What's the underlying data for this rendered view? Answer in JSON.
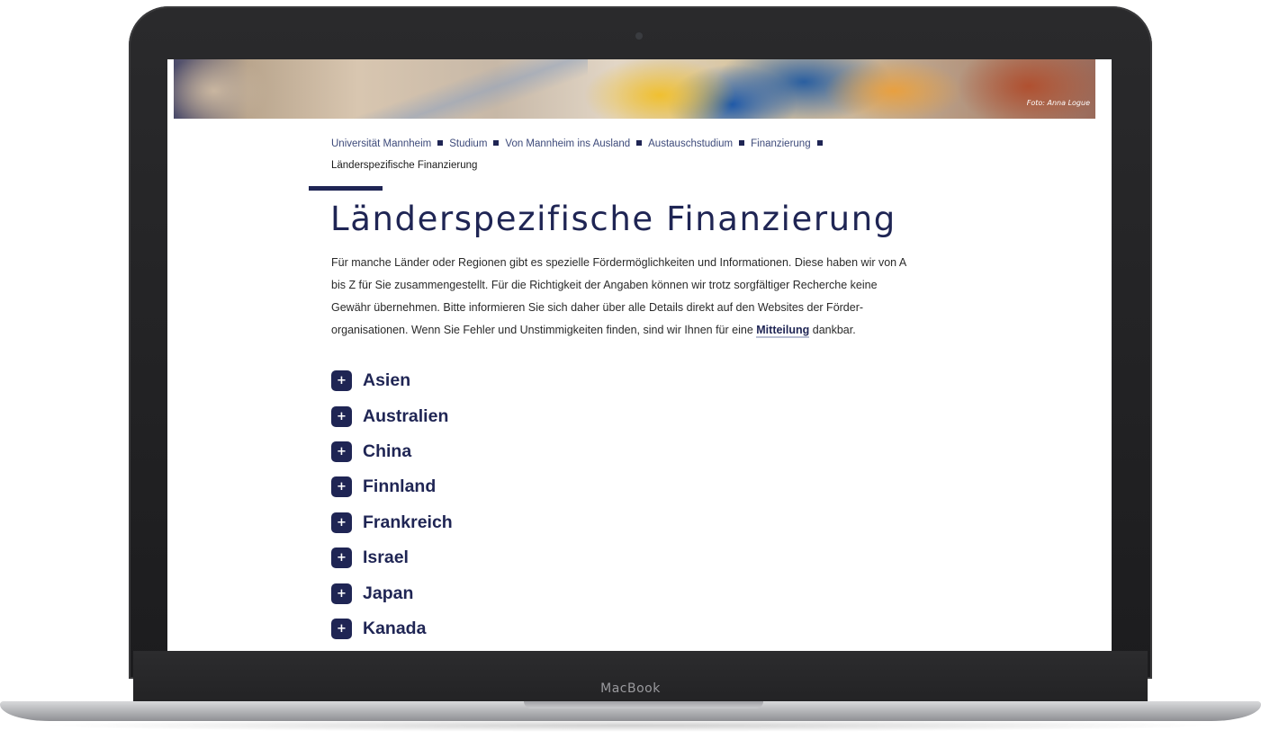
{
  "device": {
    "brand": "MacBook"
  },
  "hero": {
    "credit": "Foto: Anna Logue"
  },
  "breadcrumb": {
    "items": [
      "Universität Mannheim",
      "Studium",
      "Von Mannheim ins Ausland",
      "Austauschstudium",
      "Finanzierung"
    ],
    "current": "Länderspezifische Finanzierung"
  },
  "page": {
    "title": "Länderspezifische Finanzierung",
    "intro": {
      "line1": "Für manche Länder oder Regionen gibt es spezielle Fördermöglichkeiten und Informationen. Diese haben wir von A",
      "line2": "bis Z für Sie zusammengestellt. Für die Richtigkeit der Angaben können wir trotz sorgfältiger Recherche keine",
      "line3": "Gewähr übernehmen. Bitte informieren Sie sich daher über alle Details direkt auf den Websites der Förder-",
      "line4_before": "organisationen. Wenn Sie Fehler und Unstimmigkeiten finden, sind wir Ihnen für eine ",
      "link": "Mitteilung",
      "line4_after": " dankbar."
    }
  },
  "accordion": {
    "expand_symbol": "+",
    "items": [
      "Asien",
      "Australien",
      "China",
      "Finnland",
      "Frankreich",
      "Israel",
      "Japan",
      "Kanada"
    ]
  },
  "colors": {
    "navy": "#1f2554",
    "link_underline": "#b9bfd3"
  },
  "icons": {
    "camera": "camera-icon",
    "separator": "square-bullet-icon",
    "expand": "plus-icon"
  }
}
